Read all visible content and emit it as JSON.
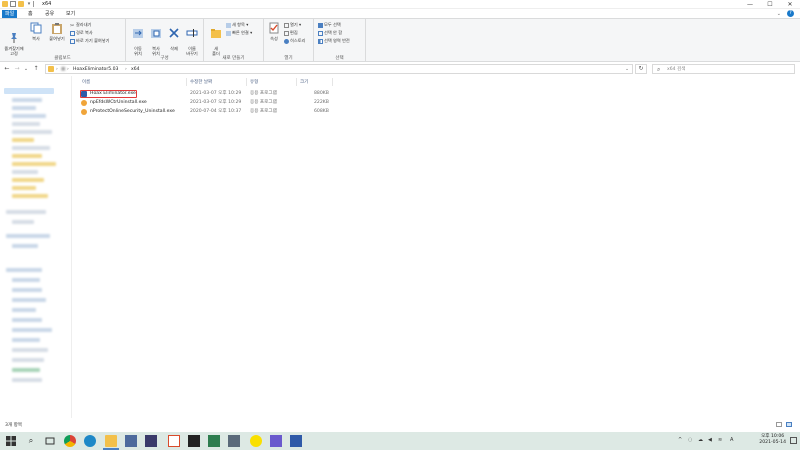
{
  "window": {
    "title": "x64",
    "controls": {
      "minimize": "—",
      "maximize": "☐",
      "close": "✕"
    }
  },
  "ribbon": {
    "tabs": [
      "파일",
      "홈",
      "공유",
      "보기"
    ],
    "active_tab": "파일",
    "clipboard": {
      "label": "클립보드",
      "pin": "즐겨찾기에\n고정",
      "copy": "복사",
      "paste": "붙여넣기",
      "cut": "잘라내기",
      "copy_path": "경로 복사",
      "paste_shortcut": "바로 가기 붙여넣기"
    },
    "organize": {
      "label": "구성",
      "move_to": "이동\n위치",
      "copy_to": "복사\n위치",
      "delete": "삭제",
      "rename": "이름\n바꾸기"
    },
    "new": {
      "label": "새로 만들기",
      "new_folder": "새\n폴더",
      "new_item": "새 항목 ▾",
      "easy_access": "빠른 연결 ▾"
    },
    "open": {
      "label": "열기",
      "properties": "속성",
      "open": "열기 ▾",
      "edit": "편집",
      "history": "히스토리"
    },
    "select": {
      "label": "선택",
      "select_all": "모두 선택",
      "select_none": "선택 안 함",
      "invert": "선택 영역 반전"
    }
  },
  "address": {
    "crumbs": [
      "HoaxEliminator5.03",
      "x64"
    ],
    "search_placeholder": "x64 검색"
  },
  "columns": {
    "name": "이름",
    "modified": "수정한 날짜",
    "type": "유형",
    "size": "크기"
  },
  "files": [
    {
      "name": "Hoax Eliminator.exe",
      "modified": "2021-03-07 오후 10:29",
      "type": "응용 프로그램",
      "size": "880KB",
      "highlighted": true,
      "icon": "hoax-app-icon"
    },
    {
      "name": "npEfdsWCtrUninstall.exe",
      "modified": "2021-03-07 오후 10:29",
      "type": "응용 프로그램",
      "size": "222KB",
      "highlighted": false,
      "icon": "installer-icon"
    },
    {
      "name": "nProtectOnlineSecurity_Uninstall.exe",
      "modified": "2020-07-04 오후 10:37",
      "type": "응용 프로그램",
      "size": "608KB",
      "highlighted": false,
      "icon": "nprotect-icon"
    }
  ],
  "status": {
    "text": "3개 항목"
  },
  "taskbar": {
    "clock_time": "오후 10:06",
    "clock_date": "2021-05-14",
    "tray_lang": "A"
  },
  "colors": {
    "accent": "#1979ca",
    "highlight_border": "#e23a3a",
    "taskbar": "#dde9e4"
  }
}
